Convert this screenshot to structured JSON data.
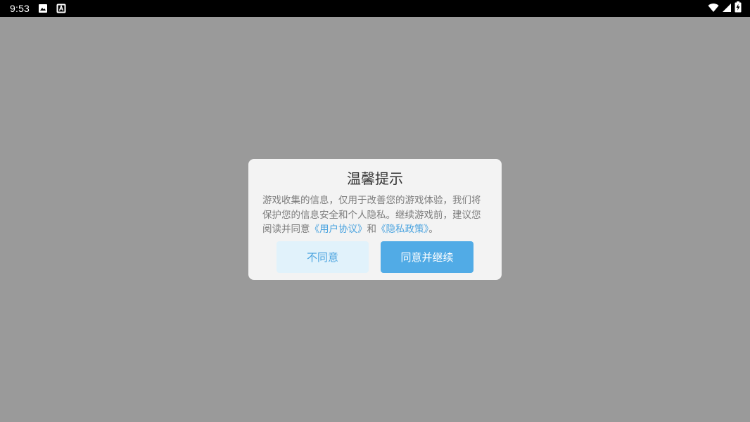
{
  "status_bar": {
    "time": "9:53",
    "left_icons": [
      "image-notification-icon",
      "text-notification-icon"
    ],
    "right_icons": [
      "wifi-icon",
      "cellular-signal-icon",
      "battery-charging-icon"
    ]
  },
  "dialog": {
    "title": "温馨提示",
    "body_text": "游戏收集的信息，仅用于改善您的游戏体验，我们将保护您的信息安全和个人隐私。继续游戏前，建议您阅读并同意",
    "user_agreement_link": "《用户协议》",
    "conjunction": "和",
    "privacy_policy_link": "《隐私政策》",
    "end_punct": "。",
    "disagree_label": "不同意",
    "agree_label": "同意并继续"
  },
  "colors": {
    "overlay": "#9a9a9a",
    "dialog_bg": "#f3f3f3",
    "link": "#4aa3df",
    "primary_button": "#51abe6",
    "secondary_button": "#e1f2fb"
  }
}
